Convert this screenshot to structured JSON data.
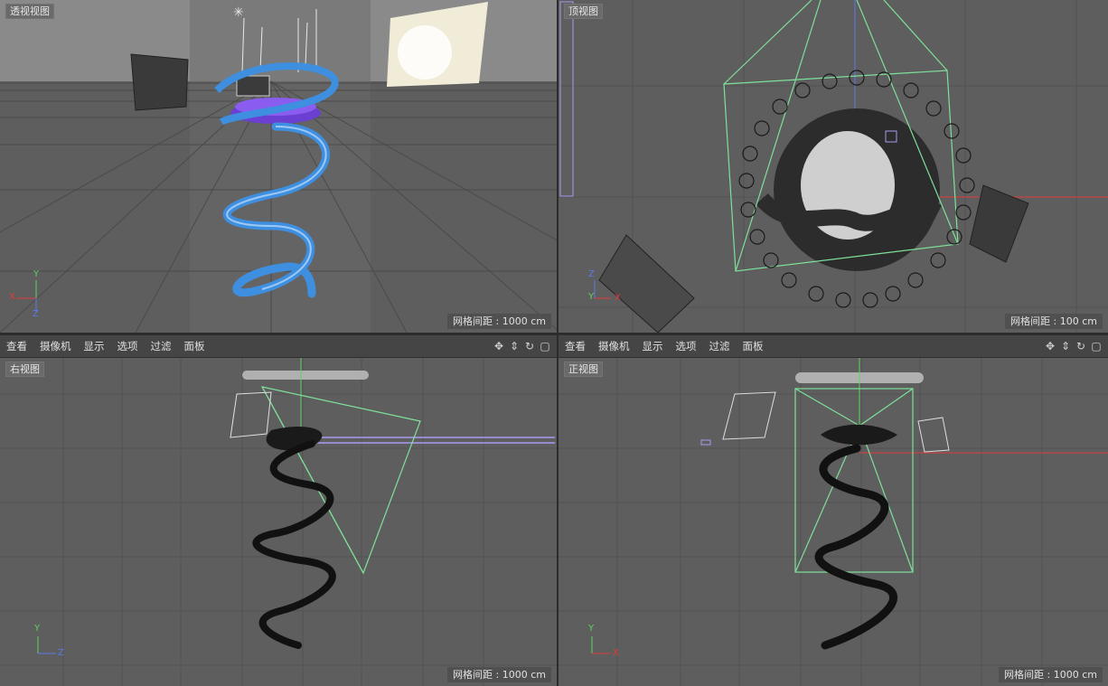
{
  "viewports": {
    "perspective": {
      "label": "透视视图",
      "grid": "网格间距 : 1000 cm"
    },
    "top": {
      "label": "顶视图",
      "grid": "网格间距 : 100 cm"
    },
    "right": {
      "label": "右视图",
      "grid": "网格间距 : 1000 cm"
    },
    "front": {
      "label": "正视图",
      "grid": "网格间距 : 1000 cm"
    }
  },
  "menu": {
    "items": [
      "查看",
      "摄像机",
      "显示",
      "选项",
      "过滤",
      "面板"
    ]
  },
  "axes": {
    "x": "X",
    "y": "Y",
    "z": "Z"
  },
  "nav_icons": [
    "move-icon",
    "dolly-icon",
    "rotate-icon",
    "maximize-icon"
  ],
  "colors": {
    "viewport_bg": "#5e5e5e",
    "grid": "#505050",
    "spring": "#3f8fe0",
    "camera_frustum": "#7ee09a",
    "x_axis": "#e23b3b",
    "y_axis": "#5fd35f",
    "z_axis": "#5a78e8"
  }
}
